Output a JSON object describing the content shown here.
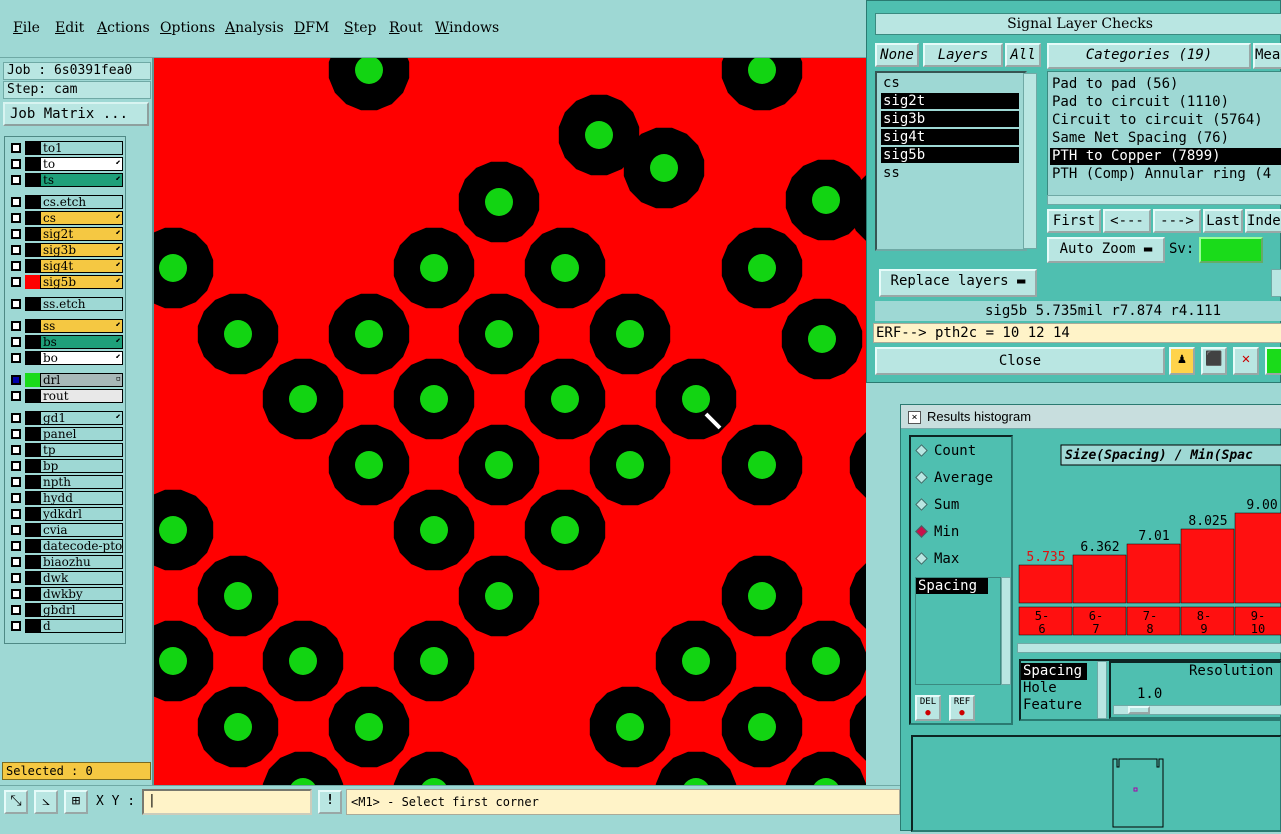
{
  "menubar": {
    "items": [
      "File",
      "Edit",
      "Actions",
      "Options",
      "Analysis",
      "DFM",
      "Step",
      "Rout",
      "Windows"
    ]
  },
  "left": {
    "job": "Job : 6s0391fea0",
    "step": "Step: cam",
    "job_matrix": "Job Matrix ...",
    "layers": [
      {
        "name": "to1",
        "color": "#9ed8d4",
        "swatch": "#000",
        "arrow": ""
      },
      {
        "name": "to",
        "color": "#ffffff",
        "swatch": "#000",
        "arrow": "⬋"
      },
      {
        "name": "ts",
        "color": "#1fa07a",
        "swatch": "#000",
        "arrow": "⬋"
      },
      {
        "name": "cs.etch",
        "color": "#9ed8d4",
        "swatch": "#000",
        "arrow": ""
      },
      {
        "name": "cs",
        "color": "#f5c842",
        "swatch": "#000",
        "arrow": "⬋"
      },
      {
        "name": "sig2t",
        "color": "#f5c842",
        "swatch": "#000",
        "arrow": "⬋"
      },
      {
        "name": "sig3b",
        "color": "#f5c842",
        "swatch": "#000",
        "arrow": "⬋"
      },
      {
        "name": "sig4t",
        "color": "#f5c842",
        "swatch": "#000",
        "arrow": "⬋"
      },
      {
        "name": "sig5b",
        "color": "#f5c842",
        "swatch": "#ff0000",
        "arrow": "⬋"
      },
      {
        "name": "ss.etch",
        "color": "#9ed8d4",
        "swatch": "#000",
        "arrow": ""
      },
      {
        "name": "ss",
        "color": "#f5c842",
        "swatch": "#000",
        "arrow": "⬋"
      },
      {
        "name": "bs",
        "color": "#1fa07a",
        "swatch": "#000",
        "arrow": "⬋"
      },
      {
        "name": "bo",
        "color": "#ffffff",
        "swatch": "#000",
        "arrow": "⬋"
      },
      {
        "name": "drl",
        "color": "#a8b8b8",
        "swatch": "#1adb1a",
        "arrow": "▫"
      },
      {
        "name": "rout",
        "color": "#e8e8e8",
        "swatch": "#000",
        "arrow": ""
      },
      {
        "name": "gd1",
        "color": "#9ed8d4",
        "swatch": "#000",
        "arrow": "⬋"
      },
      {
        "name": "panel",
        "color": "#9ed8d4",
        "swatch": "#000",
        "arrow": ""
      },
      {
        "name": "tp",
        "color": "#9ed8d4",
        "swatch": "#000",
        "arrow": ""
      },
      {
        "name": "bp",
        "color": "#9ed8d4",
        "swatch": "#000",
        "arrow": ""
      },
      {
        "name": "npth",
        "color": "#9ed8d4",
        "swatch": "#000",
        "arrow": ""
      },
      {
        "name": "hydd",
        "color": "#9ed8d4",
        "swatch": "#000",
        "arrow": ""
      },
      {
        "name": "ydkdrl",
        "color": "#9ed8d4",
        "swatch": "#000",
        "arrow": ""
      },
      {
        "name": "cvia",
        "color": "#9ed8d4",
        "swatch": "#000",
        "arrow": ""
      },
      {
        "name": "datecode-pto",
        "color": "#9ed8d4",
        "swatch": "#000",
        "arrow": ""
      },
      {
        "name": "biaozhu",
        "color": "#9ed8d4",
        "swatch": "#000",
        "arrow": ""
      },
      {
        "name": "dwk",
        "color": "#9ed8d4",
        "swatch": "#000",
        "arrow": ""
      },
      {
        "name": "dwkby",
        "color": "#9ed8d4",
        "swatch": "#000",
        "arrow": ""
      },
      {
        "name": "gbdrl",
        "color": "#9ed8d4",
        "swatch": "#000",
        "arrow": ""
      },
      {
        "name": "d",
        "color": "#9ed8d4",
        "swatch": "#000",
        "arrow": ""
      }
    ],
    "selected": "Selected : 0"
  },
  "bottom": {
    "xy_label": "X Y :",
    "xy_value": "",
    "message": "<M1> - Select first corner",
    "msg_button": "!"
  },
  "signal": {
    "title": "Signal Layer Checks",
    "none": "None",
    "layers": "Layers",
    "all": "All",
    "categories": "Categories (19)",
    "mea": "Mea",
    "layer_items": [
      {
        "name": "cs",
        "sel": false
      },
      {
        "name": "sig2t",
        "sel": true
      },
      {
        "name": "sig3b",
        "sel": true
      },
      {
        "name": "sig4t",
        "sel": true
      },
      {
        "name": "sig5b",
        "sel": true
      },
      {
        "name": "ss",
        "sel": false
      }
    ],
    "category_items": [
      {
        "name": "Pad to pad (56)",
        "sel": false
      },
      {
        "name": "Pad to circuit (1110)",
        "sel": false
      },
      {
        "name": "Circuit to circuit (5764)",
        "sel": false
      },
      {
        "name": "Same Net Spacing (76)",
        "sel": false
      },
      {
        "name": "PTH to Copper (7899)",
        "sel": true
      },
      {
        "name": "PTH (Comp) Annular ring (4",
        "sel": false
      }
    ],
    "first": "First",
    "prev": "<---",
    "next": "--->",
    "last": "Last",
    "inde": "Inde",
    "auto_zoom": "Auto Zoom",
    "sv": "Sv:",
    "replace": "Replace layers",
    "status": "sig5b 5.735mil   r7.874  r4.111",
    "erf": "ERF--> pth2c = 10 12 14",
    "close": "Close"
  },
  "histo": {
    "title": "Results histogram",
    "modes": [
      {
        "label": "Count",
        "on": false
      },
      {
        "label": "Average",
        "on": false
      },
      {
        "label": "Sum",
        "on": false
      },
      {
        "label": "Min",
        "on": true
      },
      {
        "label": "Max",
        "on": false
      }
    ],
    "list_item": "Spacing",
    "del": "DEL",
    "ref": "REF",
    "types": [
      "Spacing",
      "Hole",
      "Feature"
    ],
    "resolution": "Resolution",
    "resolution_value": "1.0"
  },
  "chart_data": {
    "type": "bar",
    "title": "Size(Spacing) / Min(Spac",
    "categories": [
      "5-6",
      "6-7",
      "7-8",
      "8-9",
      "9-10"
    ],
    "values": [
      5.735,
      6.362,
      7.01,
      8.025,
      9.0
    ],
    "value_labels": [
      "5.735",
      "6.362",
      "7.01",
      "8.025",
      "9.00"
    ],
    "ylim": [
      0,
      10
    ],
    "colors": {
      "bar": "#ff1010",
      "first_label": "#e01010"
    }
  }
}
